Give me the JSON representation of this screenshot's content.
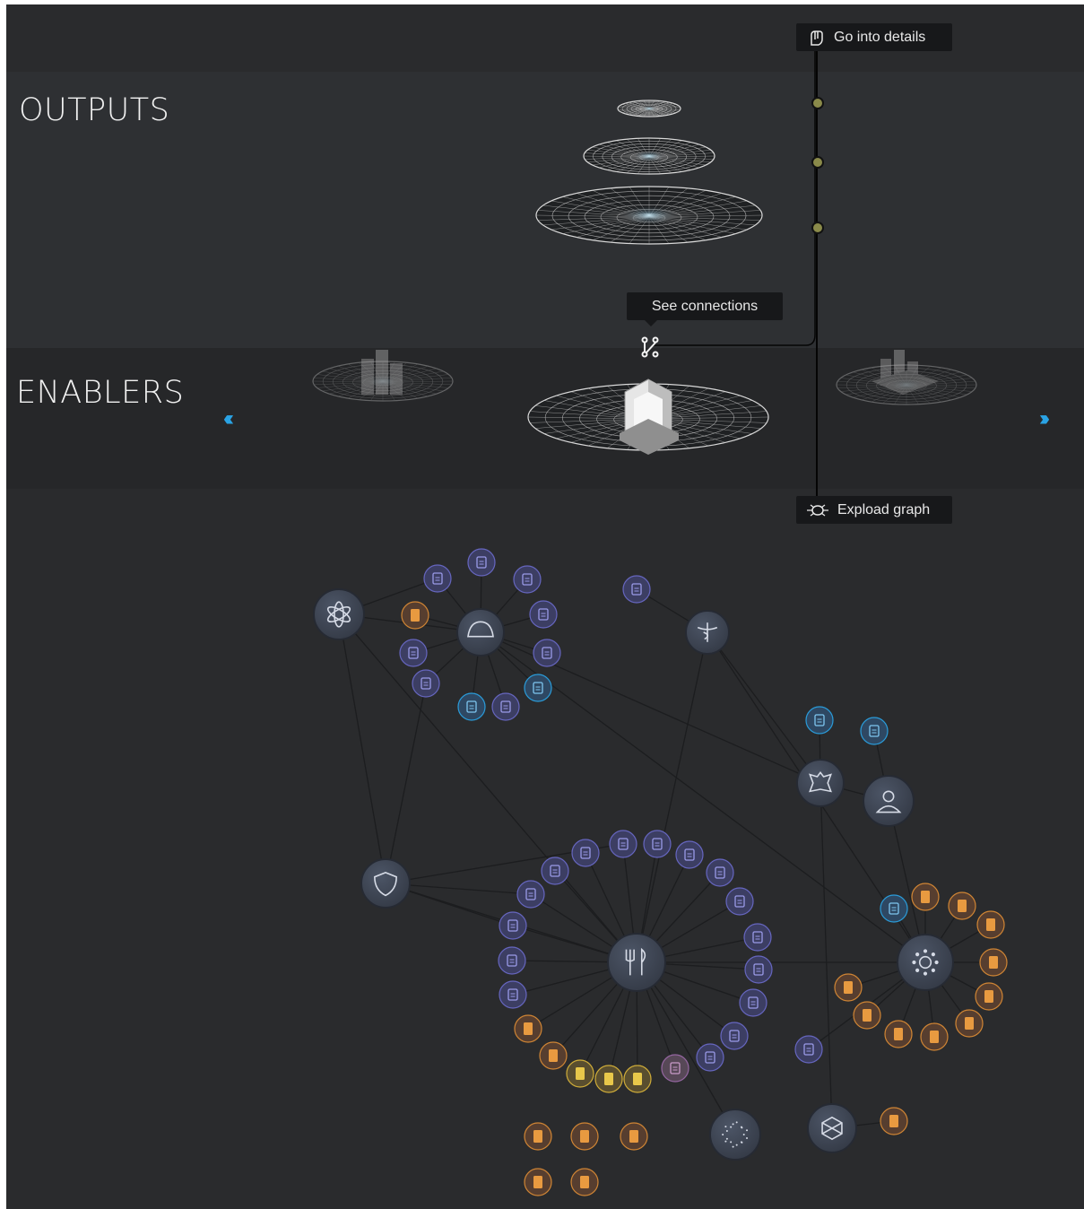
{
  "sections": {
    "outputs_title": "OUTPUTS",
    "enablers_title": "ENABLERS"
  },
  "actions": {
    "go_into_details": "Go into details",
    "see_connections": "See connections",
    "explode_graph": "Expload graph"
  },
  "nav": {
    "prev_glyph": "‹‹‹",
    "next_glyph": "›››"
  },
  "colors": {
    "background": "#2a2b2d",
    "accent_blue": "#2aa3e4",
    "node_fill": "#3b4252",
    "purple_node": "#4a4a78",
    "orange_node": "#d98a35",
    "yellow_node": "#d9b43a"
  },
  "graph": {
    "hub_icons": [
      "atom-icon",
      "hardhat-icon",
      "caduceus-icon",
      "leather-icon",
      "worker-icon",
      "shield-icon",
      "cutlery-icon",
      "sun-icon",
      "particles-icon",
      "recycle-icon"
    ]
  }
}
